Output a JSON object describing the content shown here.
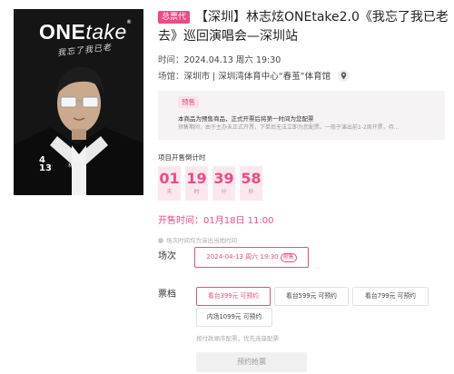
{
  "poster": {
    "logo_main": "ONE",
    "logo_italic": "take",
    "logo_mark": "®",
    "subtitle": "我忘了我已老",
    "date_month": "4",
    "date_day": "13",
    "name_small": "林志炫"
  },
  "event": {
    "tag": "总票代",
    "title": "【深圳】林志炫ONEtake2.0《我忘了我已老去》巡回演唱会—深圳站",
    "time_label": "时间：",
    "time_value": "2024.04.13 周六 19:30",
    "venue_label": "场馆：",
    "venue_value": "深圳市 | 深圳湾体育中心“春茧”体育馆"
  },
  "presale": {
    "tag": "预售",
    "line1": "本商品为预售商品，正式开票后将第一时间为您配票",
    "line2": "预售期间，由于主办未正式开票，下单后无法立即为您配票。一般于演出前1-2周开票，待…"
  },
  "countdown": {
    "label": "项目开售倒计时",
    "days": "01",
    "days_unit": "天",
    "hours": "19",
    "hours_unit": "时",
    "minutes": "39",
    "minutes_unit": "分",
    "seconds": "58",
    "seconds_unit": "秒"
  },
  "sale": {
    "time_text": "开售时间：01月18日 11:00",
    "note": "场次时间均为演出当地时间"
  },
  "session": {
    "label": "场次",
    "option": "2024-04-13 周六 19:30",
    "badge": "预售"
  },
  "tickets": {
    "label": "票档",
    "tiers": [
      "看台399元 可预约",
      "看台599元 可预约",
      "看台799元 可预约",
      "内场1099元 可预约"
    ],
    "note": "按付款顺序配票，优先连座配票"
  },
  "action": {
    "reserve_label": "预约抢票"
  },
  "colors": {
    "accent": "#ea4b85",
    "poster_bg": "#151515"
  }
}
